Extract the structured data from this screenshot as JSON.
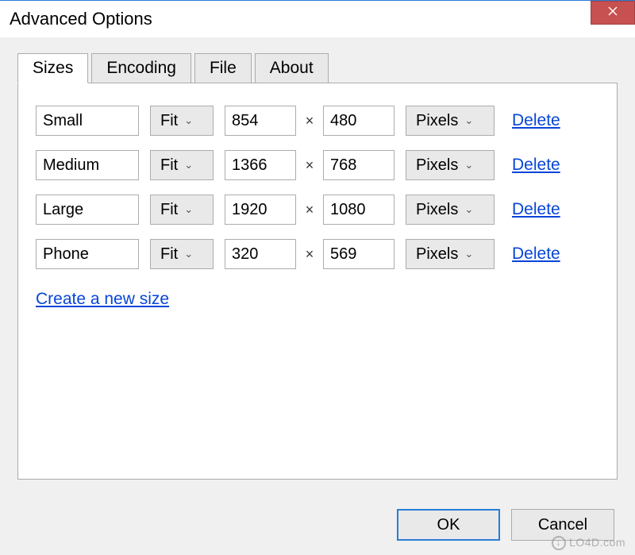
{
  "window": {
    "title": "Advanced Options"
  },
  "tabs": [
    {
      "label": "Sizes",
      "active": true
    },
    {
      "label": "Encoding",
      "active": false
    },
    {
      "label": "File",
      "active": false
    },
    {
      "label": "About",
      "active": false
    }
  ],
  "sizes": [
    {
      "name": "Small",
      "fit": "Fit",
      "width": "854",
      "height": "480",
      "units": "Pixels",
      "delete": "Delete"
    },
    {
      "name": "Medium",
      "fit": "Fit",
      "width": "1366",
      "height": "768",
      "units": "Pixels",
      "delete": "Delete"
    },
    {
      "name": "Large",
      "fit": "Fit",
      "width": "1920",
      "height": "1080",
      "units": "Pixels",
      "delete": "Delete"
    },
    {
      "name": "Phone",
      "fit": "Fit",
      "width": "320",
      "height": "569",
      "units": "Pixels",
      "delete": "Delete"
    }
  ],
  "multiply_symbol": "×",
  "create_link": "Create a new size",
  "buttons": {
    "ok": "OK",
    "cancel": "Cancel"
  },
  "watermark": "LO4D.com"
}
